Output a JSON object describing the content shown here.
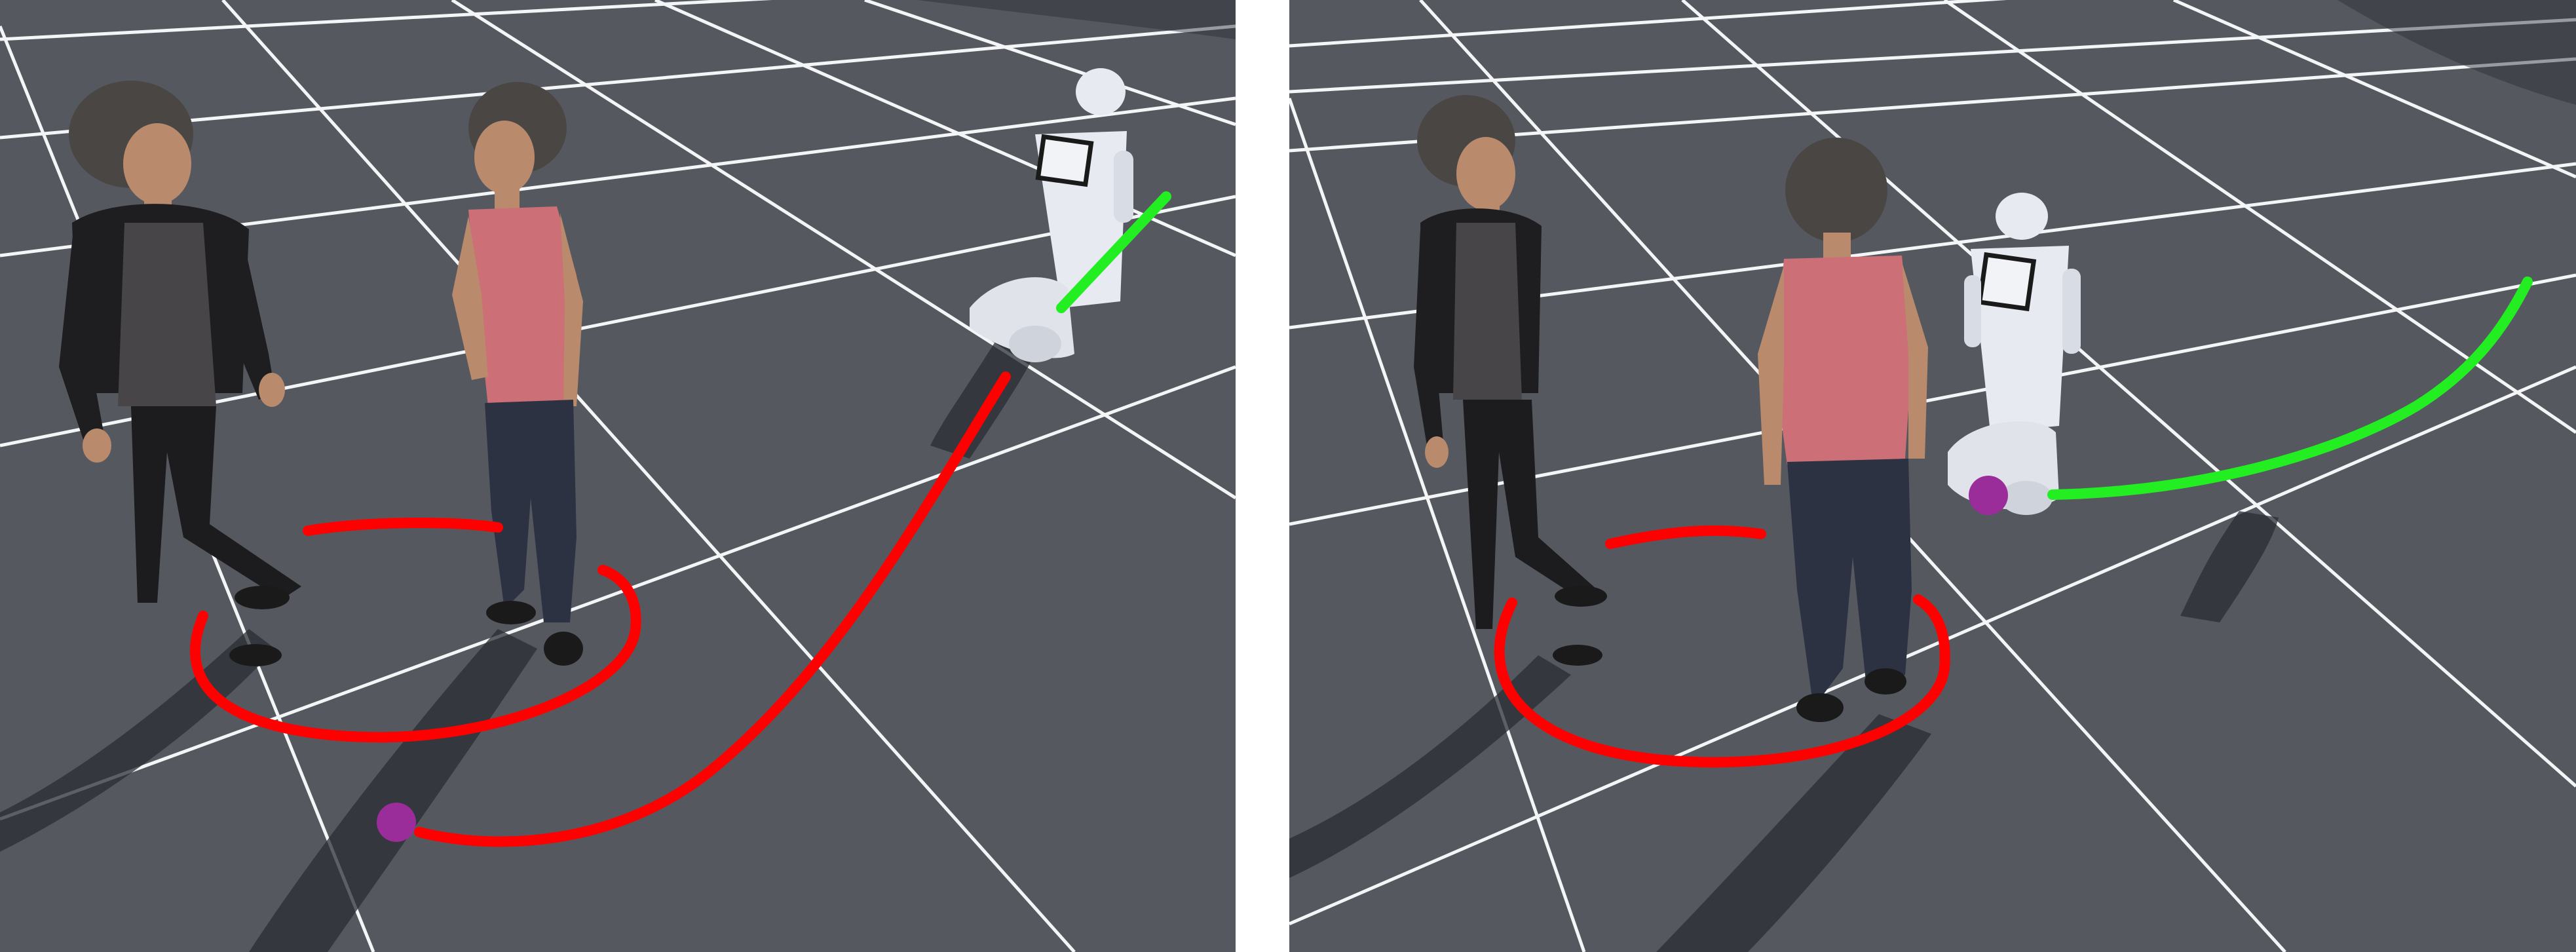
{
  "figure": {
    "panels": [
      {
        "id": "left"
      },
      {
        "id": "right"
      }
    ]
  },
  "colors": {
    "ground": "#55595f",
    "grid": "#f4f5f7",
    "planned_path": "#ff0000",
    "robot_path": "#22ee22",
    "goal_marker": "#9b2d9b",
    "shadow": "#2a2d33",
    "skin": "#b98a6c",
    "hair": "#4a4644",
    "black_top": "#1e1d1f",
    "pink_top": "#cc6f76",
    "jeans": "#2d3242",
    "robot_body": "#e7eaf0"
  },
  "icons": {
    "goal": "purple-dot-icon",
    "robot": "pepper-robot-icon"
  }
}
